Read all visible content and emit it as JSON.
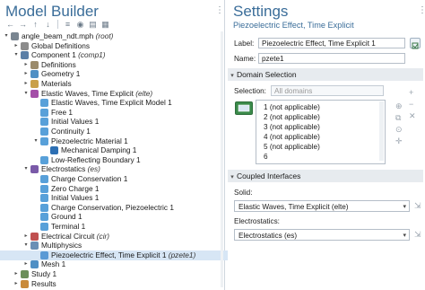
{
  "builder": {
    "title": "Model Builder",
    "tree": [
      {
        "depth": 0,
        "tog": "▾",
        "icon": "#7a8691",
        "label": "angle_beam_ndt.mph",
        "sub": "(root)"
      },
      {
        "depth": 1,
        "tog": "▸",
        "icon": "#8c8c8c",
        "label": "Global Definitions",
        "sub": ""
      },
      {
        "depth": 1,
        "tog": "▾",
        "icon": "#5b7fa6",
        "label": "Component 1",
        "sub": "(comp1)"
      },
      {
        "depth": 2,
        "tog": "▸",
        "icon": "#9b8b6b",
        "label": "Definitions",
        "sub": ""
      },
      {
        "depth": 2,
        "tog": "▸",
        "icon": "#4f8fc4",
        "label": "Geometry 1",
        "sub": ""
      },
      {
        "depth": 2,
        "tog": "▸",
        "icon": "#c9a04a",
        "label": "Materials",
        "sub": ""
      },
      {
        "depth": 2,
        "tog": "▾",
        "icon": "#a44fa8",
        "label": "Elastic Waves, Time Explicit",
        "sub": "(elte)"
      },
      {
        "depth": 3,
        "tog": "",
        "icon": "#58a0d9",
        "label": "Elastic Waves, Time Explicit Model 1",
        "sub": ""
      },
      {
        "depth": 3,
        "tog": "",
        "icon": "#58a0d9",
        "label": "Free 1",
        "sub": ""
      },
      {
        "depth": 3,
        "tog": "",
        "icon": "#58a0d9",
        "label": "Initial Values 1",
        "sub": ""
      },
      {
        "depth": 3,
        "tog": "",
        "icon": "#58a0d9",
        "label": "Continuity 1",
        "sub": ""
      },
      {
        "depth": 3,
        "tog": "▾",
        "icon": "#58a0d9",
        "label": "Piezoelectric Material 1",
        "sub": ""
      },
      {
        "depth": 4,
        "tog": "",
        "icon": "#2d6fb3",
        "label": "Mechanical Damping 1",
        "sub": ""
      },
      {
        "depth": 3,
        "tog": "",
        "icon": "#58a0d9",
        "label": "Low-Reflecting Boundary 1",
        "sub": ""
      },
      {
        "depth": 2,
        "tog": "▾",
        "icon": "#7a5aa8",
        "label": "Electrostatics",
        "sub": "(es)"
      },
      {
        "depth": 3,
        "tog": "",
        "icon": "#58a0d9",
        "label": "Charge Conservation 1",
        "sub": ""
      },
      {
        "depth": 3,
        "tog": "",
        "icon": "#58a0d9",
        "label": "Zero Charge 1",
        "sub": ""
      },
      {
        "depth": 3,
        "tog": "",
        "icon": "#58a0d9",
        "label": "Initial Values 1",
        "sub": ""
      },
      {
        "depth": 3,
        "tog": "",
        "icon": "#58a0d9",
        "label": "Charge Conservation, Piezoelectric 1",
        "sub": ""
      },
      {
        "depth": 3,
        "tog": "",
        "icon": "#58a0d9",
        "label": "Ground 1",
        "sub": ""
      },
      {
        "depth": 3,
        "tog": "",
        "icon": "#58a0d9",
        "label": "Terminal 1",
        "sub": ""
      },
      {
        "depth": 2,
        "tog": "▸",
        "icon": "#c05050",
        "label": "Electrical Circuit",
        "sub": "(cir)"
      },
      {
        "depth": 2,
        "tog": "▾",
        "icon": "#6a8fb5",
        "label": "Multiphysics",
        "sub": ""
      },
      {
        "depth": 3,
        "tog": "",
        "icon": "#5b9ad5",
        "label": "Piezoelectric Effect, Time Explicit 1",
        "sub": "(pzete1)",
        "selected": true
      },
      {
        "depth": 2,
        "tog": "▸",
        "icon": "#4f8fc4",
        "label": "Mesh 1",
        "sub": ""
      },
      {
        "depth": 1,
        "tog": "▸",
        "icon": "#6b8e5a",
        "label": "Study 1",
        "sub": ""
      },
      {
        "depth": 1,
        "tog": "▸",
        "icon": "#c98a3a",
        "label": "Results",
        "sub": ""
      }
    ]
  },
  "settings": {
    "title": "Settings",
    "subtitle": "Piezoelectric Effect, Time Explicit",
    "label_caption": "Label:",
    "label_value": "Piezoelectric Effect, Time Explicit 1",
    "name_caption": "Name:",
    "name_value": "pzete1",
    "domain_section": "Domain Selection",
    "selection_caption": "Selection:",
    "selection_value": "All domains",
    "domains": [
      "1 (not applicable)",
      "2 (not applicable)",
      "3 (not applicable)",
      "4 (not applicable)",
      "5 (not applicable)",
      "6"
    ],
    "coupled_section": "Coupled Interfaces",
    "solid_caption": "Solid:",
    "solid_value": "Elastic Waves, Time Explicit (elte)",
    "electro_caption": "Electrostatics:",
    "electro_value": "Electrostatics (es)"
  }
}
